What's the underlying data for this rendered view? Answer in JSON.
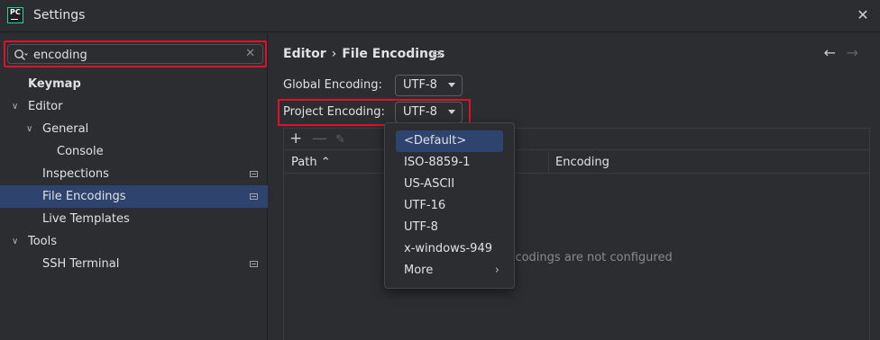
{
  "window": {
    "title": "Settings",
    "logo_text": "PC",
    "close_glyph": "✕"
  },
  "search": {
    "value": "encoding",
    "clear_glyph": "✕"
  },
  "sidebar": {
    "items": [
      {
        "label": "Keymap",
        "level": 0,
        "bold": true
      },
      {
        "label": "Editor",
        "level": 0,
        "expanded": true
      },
      {
        "label": "General",
        "level": 1,
        "expanded": true
      },
      {
        "label": "Console",
        "level": 2
      },
      {
        "label": "Inspections",
        "level": 1,
        "page_icon": true
      },
      {
        "label": "File Encodings",
        "level": 1,
        "selected": true,
        "page_icon": true
      },
      {
        "label": "Live Templates",
        "level": 1
      },
      {
        "label": "Tools",
        "level": 0,
        "expanded": true
      },
      {
        "label": "SSH Terminal",
        "level": 1,
        "page_icon": true
      }
    ]
  },
  "breadcrumb": {
    "parent": "Editor",
    "separator": "›",
    "current": "File Encodings"
  },
  "nav": {
    "back": "←",
    "forward": "→"
  },
  "form": {
    "global_label": "Global Encoding:",
    "global_value": "UTF-8",
    "project_label": "Project Encoding:",
    "project_value": "UTF-8"
  },
  "table": {
    "toolbar": {
      "add": "+",
      "remove": "—",
      "edit": "✎"
    },
    "columns": [
      "Path",
      "Encoding"
    ],
    "sort_indicator": "⌃",
    "empty_text": "Encodings are not configured"
  },
  "popup": {
    "items": [
      {
        "label": "<Default>",
        "selected": true
      },
      {
        "label": "ISO-8859-1"
      },
      {
        "label": "US-ASCII"
      },
      {
        "label": "UTF-16"
      },
      {
        "label": "UTF-8"
      },
      {
        "label": "x-windows-949"
      },
      {
        "label": "More",
        "submenu": true
      }
    ],
    "submenu_glyph": "›"
  },
  "colors": {
    "background": "#2b2d30",
    "selection": "#2e436e",
    "highlight_border": "#e0102a",
    "text": "#dfe1e5"
  }
}
